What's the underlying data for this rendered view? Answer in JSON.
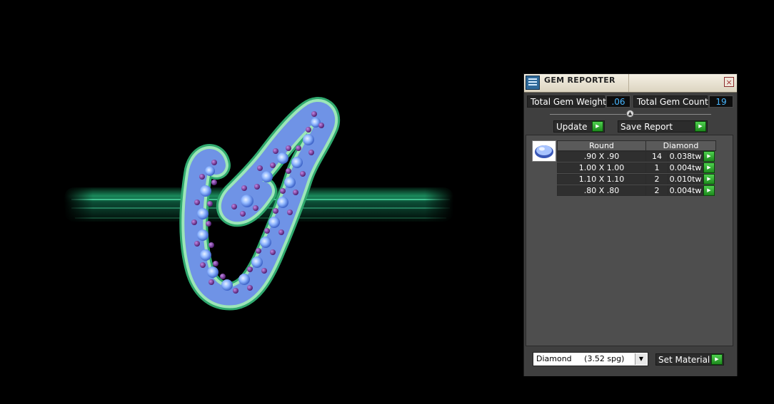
{
  "panel": {
    "title": "GEM REPORTER",
    "close_glyph": "×",
    "total_weight_label": "Total Gem Weight",
    "total_weight_value": ".06",
    "total_count_label": "Total Gem Count",
    "total_count_value": "19",
    "update_label": "Update",
    "save_report_label": "Save Report",
    "table": {
      "col_shape": "Round",
      "col_material": "Diamond",
      "rows": [
        {
          "size": ".90 X .90",
          "count": "14",
          "weight": "0.038tw"
        },
        {
          "size": "1.00 X 1.00",
          "count": "1",
          "weight": "0.004tw"
        },
        {
          "size": "1.10 X 1.10",
          "count": "2",
          "weight": "0.010tw"
        },
        {
          "size": ".80 X .80",
          "count": "2",
          "weight": "0.004tw"
        }
      ]
    },
    "material_select_value": "Diamond     (3.52 spg)",
    "set_material_label": "Set Material"
  },
  "icons": {
    "go": "play-arrow-icon",
    "gem": "round-gem-icon",
    "app": "gem-reporter-icon",
    "close": "close-icon",
    "dropdown": "chevron-down-icon"
  },
  "colors": {
    "value_text": "#47b6ff",
    "go_button": "#2fb02f",
    "ring_band": "#1f8a5e",
    "gem_blue": "#8fb6ff",
    "gem_purple": "#6a2a8a"
  }
}
